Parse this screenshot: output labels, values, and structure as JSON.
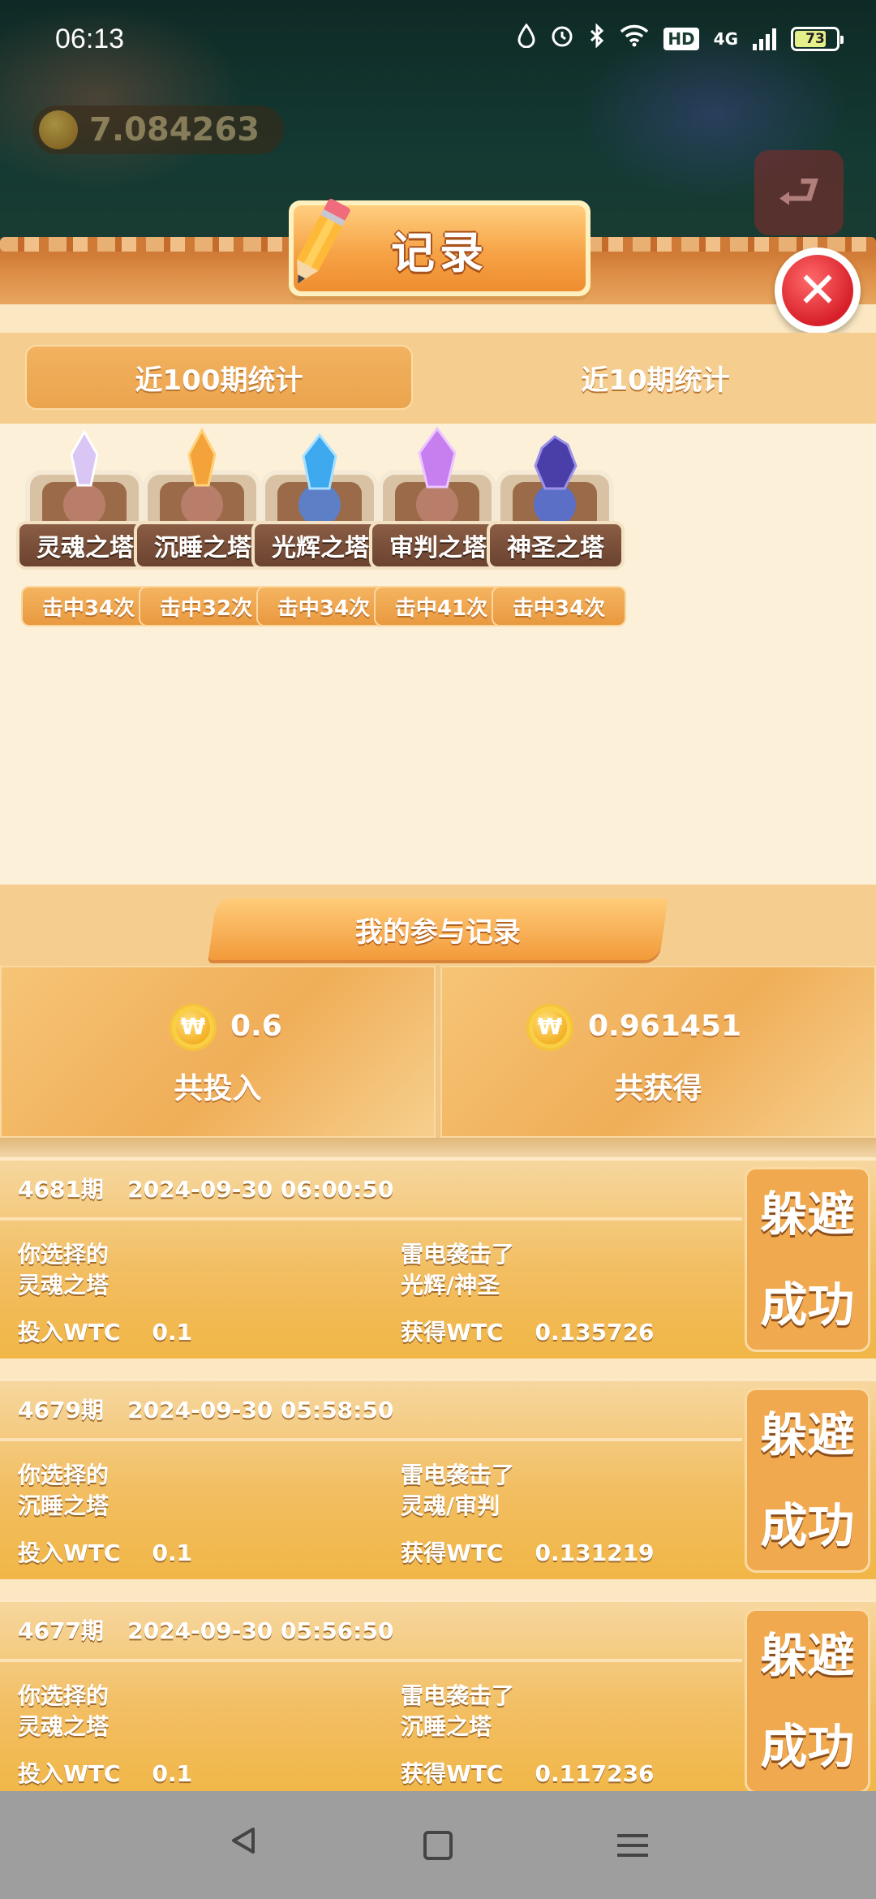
{
  "status_bar": {
    "time": "06:13",
    "network": "4G",
    "hd": "HD",
    "battery": "73",
    "icons": [
      "water-drop-icon",
      "alarm-icon",
      "bluetooth-icon",
      "wifi-icon",
      "hd-icon",
      "signal-icon",
      "battery-icon"
    ]
  },
  "background": {
    "coin_balance": "7.084263",
    "exit_icon": "exit-icon"
  },
  "dialog": {
    "title": "记录",
    "close_icon": "close-icon",
    "tabs": [
      {
        "label": "近100期统计",
        "active": true
      },
      {
        "label": "近10期统计",
        "active": false
      }
    ]
  },
  "towers": [
    {
      "name": "灵魂之塔",
      "hits": "击中34次",
      "crystal_color": "#d9c6f5"
    },
    {
      "name": "沉睡之塔",
      "hits": "击中32次",
      "crystal_color": "#f4a23a"
    },
    {
      "name": "光辉之塔",
      "hits": "击中34次",
      "crystal_color": "#3fa9f0"
    },
    {
      "name": "审判之塔",
      "hits": "击中41次",
      "crystal_color": "#c77ff0"
    },
    {
      "name": "神圣之塔",
      "hits": "击中34次",
      "crystal_color": "#4a3fa8"
    }
  ],
  "my_records": {
    "title": "我的参与记录",
    "total_invest_amount": "0.6",
    "total_invest_label": "共投入",
    "total_gain_amount": "0.961451",
    "total_gain_label": "共获得"
  },
  "records": [
    {
      "period": "4681期",
      "datetime": "2024-09-30 06:00:50",
      "chosen_label": "你选择的",
      "chosen": "灵魂之塔",
      "hit_label": "雷电袭击了",
      "hit": "光辉/神圣",
      "invest": "投入WTC    0.1",
      "gain": "获得WTC    0.135726",
      "result_line1": "躲避",
      "result_line2": "成功"
    },
    {
      "period": "4679期",
      "datetime": "2024-09-30 05:58:50",
      "chosen_label": "你选择的",
      "chosen": "沉睡之塔",
      "hit_label": "雷电袭击了",
      "hit": "灵魂/审判",
      "invest": "投入WTC    0.1",
      "gain": "获得WTC    0.131219",
      "result_line1": "躲避",
      "result_line2": "成功"
    },
    {
      "period": "4677期",
      "datetime": "2024-09-30 05:56:50",
      "chosen_label": "你选择的",
      "chosen": "灵魂之塔",
      "hit_label": "雷电袭击了",
      "hit": "沉睡之塔",
      "invest": "投入WTC    0.1",
      "gain": "获得WTC    0.117236",
      "result_line1": "躲避",
      "result_line2": "成功"
    }
  ],
  "nav": {
    "back_icon": "back-icon",
    "home_icon": "home-icon",
    "menu_icon": "menu-icon"
  }
}
